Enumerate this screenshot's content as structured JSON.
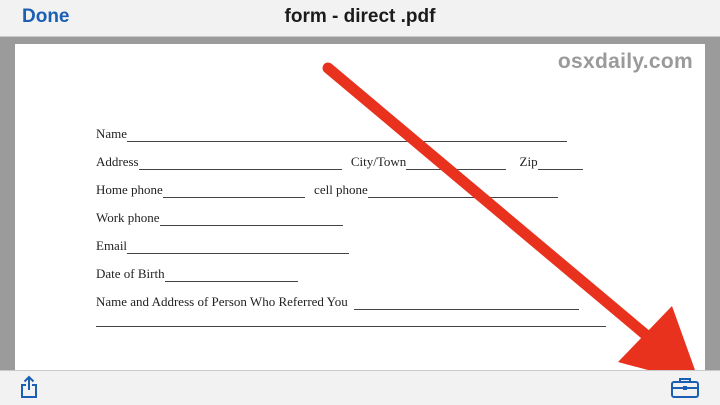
{
  "header": {
    "done_label": "Done",
    "title": "form - direct .pdf"
  },
  "watermark": "osxdaily.com",
  "form": {
    "name_label": "Name",
    "address_label": "Address",
    "city_label": "City/Town",
    "zip_label": "Zip",
    "home_phone_label": "Home phone",
    "cell_phone_label": "cell phone",
    "work_phone_label": "Work phone",
    "email_label": "Email",
    "dob_label": "Date of Birth",
    "referrer_label": "Name and Address of  Person Who Referred You"
  },
  "colors": {
    "accent": "#1a5fb4",
    "arrow": "#e8321e",
    "toolbar": "#f2f2f2"
  },
  "icons": {
    "share": "share-icon",
    "markup": "toolbox-icon"
  }
}
